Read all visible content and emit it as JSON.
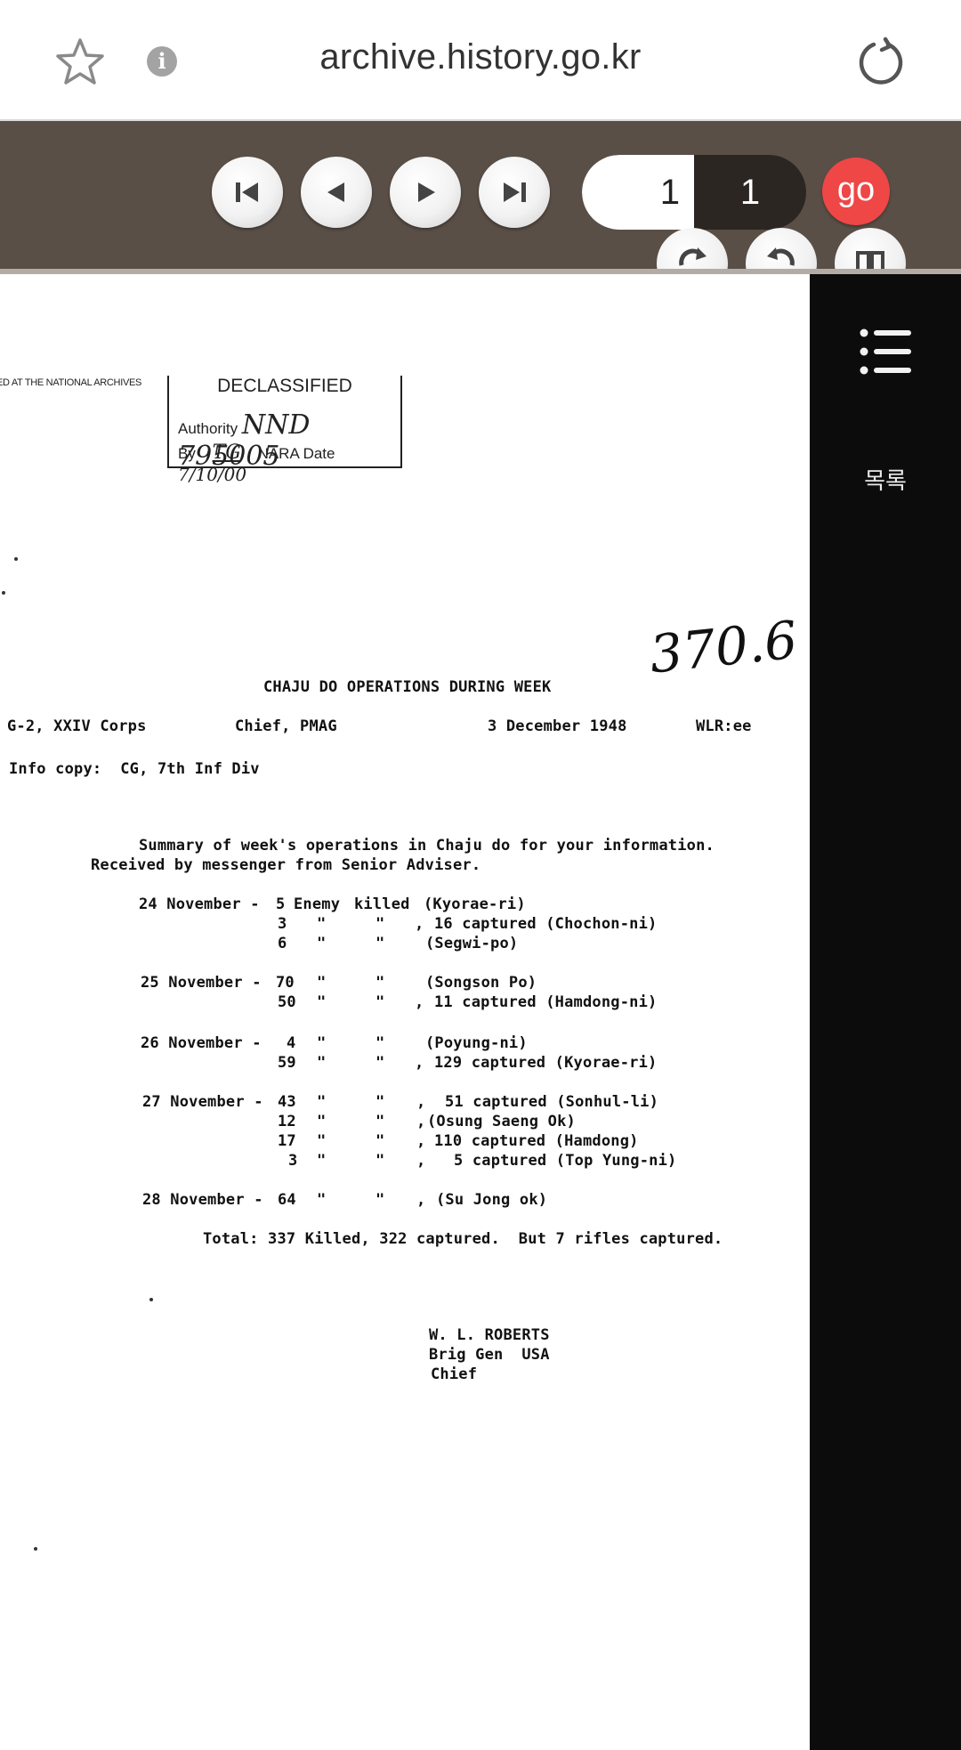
{
  "browser": {
    "url": "archive.history.go.kr",
    "icons": {
      "favorite": "star-outline-icon",
      "info": "info-icon",
      "reload": "reload-icon"
    },
    "info_glyph": "i"
  },
  "viewer": {
    "nav_icons": [
      "first-page-icon",
      "previous-page-icon",
      "next-page-icon",
      "last-page-icon"
    ],
    "page_current": "1",
    "page_total": "1",
    "go_label": "go",
    "go_color": "#ef4646",
    "toolbar_color": "#5a4f47"
  },
  "document": {
    "archives_note": "ED AT THE NATIONAL ARCHIVES",
    "stamp": {
      "title": "DECLASSIFIED",
      "authority_label": "Authority",
      "authority_value": "NND 795005",
      "by_label": "By",
      "by_value": "TG",
      "nara_label": "NARA Date",
      "date_value": "7/10/00"
    },
    "handwritten_note": "370.6",
    "title": "CHAJU DO OPERATIONS DURING WEEK",
    "header": {
      "to": "G-2, XXIV Corps",
      "from": "Chief, PMAG",
      "date": "3 December 1948",
      "ref": "WLR:ee"
    },
    "info_copy": "Info copy:  CG, 7th Inf Div",
    "summary_line1": "Summary of week's operations in Chaju do for your information.",
    "summary_line2": "Received by messenger from Senior Adviser.",
    "rows": [
      {
        "date": "24 November - ",
        "n": "5",
        "q1": "Enemy",
        "q2": "killed",
        "comma": "",
        "capt": "(Kyorae-ri)"
      },
      {
        "date": "",
        "n": "3",
        "q1": "\"",
        "q2": "\"",
        "comma": ",",
        "capt": "16 captured (Chochon-ni)"
      },
      {
        "date": "",
        "n": "6",
        "q1": "\"",
        "q2": "\"",
        "comma": "",
        "capt": "(Segwi-po)"
      },
      {
        "date": "25 November - ",
        "n": "70",
        "q1": "\"",
        "q2": "\"",
        "comma": "",
        "capt": "(Songson Po)"
      },
      {
        "date": "",
        "n": "50",
        "q1": "\"",
        "q2": "\"",
        "comma": ",",
        "capt": "11 captured (Hamdong-ni)"
      },
      {
        "date": "26 November - ",
        "n": "4",
        "q1": "\"",
        "q2": "\"",
        "comma": "",
        "capt": "(Poyung-ni)"
      },
      {
        "date": "",
        "n": "59",
        "q1": "\"",
        "q2": "\"",
        "comma": ",",
        "capt": "129 captured (Kyorae-ri)"
      },
      {
        "date": "27 November - ",
        "n": "43",
        "q1": "\"",
        "q2": "\"",
        "comma": ",",
        "capt": "51 captured (Sonhul-li)"
      },
      {
        "date": "",
        "n": "12",
        "q1": "\"",
        "q2": "\"",
        "comma": ",",
        "capt": "(Osung Saeng Ok)"
      },
      {
        "date": "",
        "n": "17",
        "q1": "\"",
        "q2": "\"",
        "comma": ",",
        "capt": "110 captured (Hamdong)"
      },
      {
        "date": "",
        "n": "3",
        "q1": "\"",
        "q2": "\"",
        "comma": ",",
        "capt": "5 captured (Top Yung-ni)"
      },
      {
        "date": "28 November - ",
        "n": "64",
        "q1": "\"",
        "q2": "\"",
        "comma": ",",
        "capt": "(Su Jong ok)"
      }
    ],
    "total": "Total: 337 Killed, 322 captured.  But 7 rifles captured.",
    "signature": [
      "W. L. ROBERTS",
      "Brig Gen  USA",
      "Chief"
    ]
  },
  "side_panel": {
    "icon": "list-icon",
    "label": "목록"
  }
}
